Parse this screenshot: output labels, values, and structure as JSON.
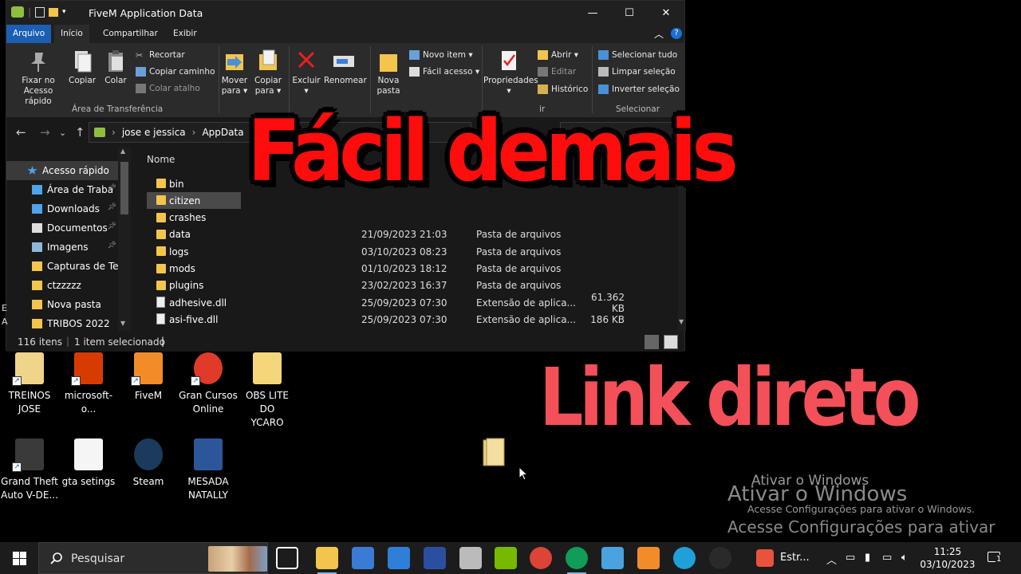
{
  "window": {
    "title": "FiveM Application Data",
    "controls": {
      "minimize": "—",
      "maximize": "☐",
      "close": "✕"
    }
  },
  "ribbon_tabs": [
    "Arquivo",
    "Início",
    "Compartilhar",
    "Exibir"
  ],
  "ribbon": {
    "clipboard": {
      "pin": "Fixar no\nAcesso rápido",
      "copy": "Copiar",
      "paste": "Colar",
      "cut": "Recortar",
      "copy_path": "Copiar caminho",
      "paste_shortcut": "Colar atalho",
      "group": "Área de Transferência"
    },
    "organize": {
      "move": "Mover\npara ▾",
      "copy_to": "Copiar\npara ▾",
      "delete": "Excluir\n▾",
      "rename": "Renomear"
    },
    "new": {
      "new_folder": "Nova\npasta",
      "new_item": "Novo item ▾",
      "easy_access": "Fácil acesso ▾"
    },
    "open": {
      "properties": "Propriedades\n▾",
      "open": "Abrir ▾",
      "edit": "Editar",
      "history": "Histórico",
      "group_fragment": "ir"
    },
    "select": {
      "select_all": "Selecionar tudo",
      "clear": "Limpar seleção",
      "invert": "Inverter seleção",
      "group": "Selecionar"
    }
  },
  "address": {
    "crumbs": [
      "jose e jessica",
      "AppData"
    ],
    "sep": "›"
  },
  "nav": [
    {
      "label": "Acesso rápido",
      "icon": "star-icon",
      "pinned": false
    },
    {
      "label": "Área de Traba",
      "icon": "desktop-icon",
      "pinned": true
    },
    {
      "label": "Downloads",
      "icon": "download-icon",
      "pinned": true
    },
    {
      "label": "Documentos",
      "icon": "document-icon",
      "pinned": true
    },
    {
      "label": "Imagens",
      "icon": "pictures-icon",
      "pinned": true
    },
    {
      "label": "Capturas de Tela",
      "icon": "folder-icon",
      "pinned": false
    },
    {
      "label": "ctzzzzz",
      "icon": "folder-icon",
      "pinned": false
    },
    {
      "label": "Nova pasta",
      "icon": "folder-icon",
      "pinned": false
    },
    {
      "label": "TRIBOS 2022",
      "icon": "folder-icon",
      "pinned": false
    }
  ],
  "files": {
    "column_name": "Nome",
    "rows": [
      {
        "name": "bin",
        "date": "",
        "type": "",
        "size": "",
        "kind": "folder"
      },
      {
        "name": "citizen",
        "date": "",
        "type": "",
        "size": "",
        "kind": "folder",
        "selected": true
      },
      {
        "name": "crashes",
        "date": "",
        "type": "",
        "size": "",
        "kind": "folder"
      },
      {
        "name": "data",
        "date": "21/09/2023 21:03",
        "type": "Pasta de arquivos",
        "size": "",
        "kind": "folder"
      },
      {
        "name": "logs",
        "date": "03/10/2023 08:23",
        "type": "Pasta de arquivos",
        "size": "",
        "kind": "folder"
      },
      {
        "name": "mods",
        "date": "01/10/2023 18:12",
        "type": "Pasta de arquivos",
        "size": "",
        "kind": "folder"
      },
      {
        "name": "plugins",
        "date": "23/02/2023 16:37",
        "type": "Pasta de arquivos",
        "size": "",
        "kind": "folder"
      },
      {
        "name": "adhesive.dll",
        "date": "25/09/2023 07:30",
        "type": "Extensão de aplica...",
        "size": "61.362 KB",
        "kind": "file"
      },
      {
        "name": "asi-five.dll",
        "date": "25/09/2023 07:30",
        "type": "Extensão de aplica...",
        "size": "186 KB",
        "kind": "file"
      }
    ]
  },
  "status": {
    "count": "116 itens",
    "selection": "1 item selecionado"
  },
  "overlay": {
    "headline": "Fácil demais",
    "subline": "Link direto"
  },
  "desktop_icons": [
    {
      "label": "TREINOS\nJOSE",
      "color": "#f0d48a"
    },
    {
      "label": "microsoft-o...",
      "color": "#d83b01"
    },
    {
      "label": "FiveM",
      "color": "#f28c28"
    },
    {
      "label": "Gran Cursos\nOnline",
      "color": "#e03a2a"
    },
    {
      "label": "OBS LITE DO\nYCARO",
      "color": "#f3d77a"
    },
    {
      "label": "Grand Theft\nAuto V-DE...",
      "color": "#3a3a3a"
    },
    {
      "label": "gta setings",
      "color": "#f5f5f5"
    },
    {
      "label": "Steam",
      "color": "#1b3a5c"
    },
    {
      "label": "MESADA\nNATALLY",
      "color": "#2b579a"
    }
  ],
  "activation": {
    "title": "Ativar o Windows",
    "line1": "Acesse Configurações para ativar o Windows.",
    "line2": "Acesse Configurações para ativar",
    "ghost": "Ativar o Windows"
  },
  "taskbar": {
    "search_placeholder": "Pesquisar",
    "pinned_app_label": "Estr...",
    "time": "11:25",
    "date": "03/10/2023",
    "notification_count": "1"
  },
  "colors": {
    "headline": "#ff0d0d",
    "subline": "#f4505a",
    "accent": "#1a5fb4"
  }
}
